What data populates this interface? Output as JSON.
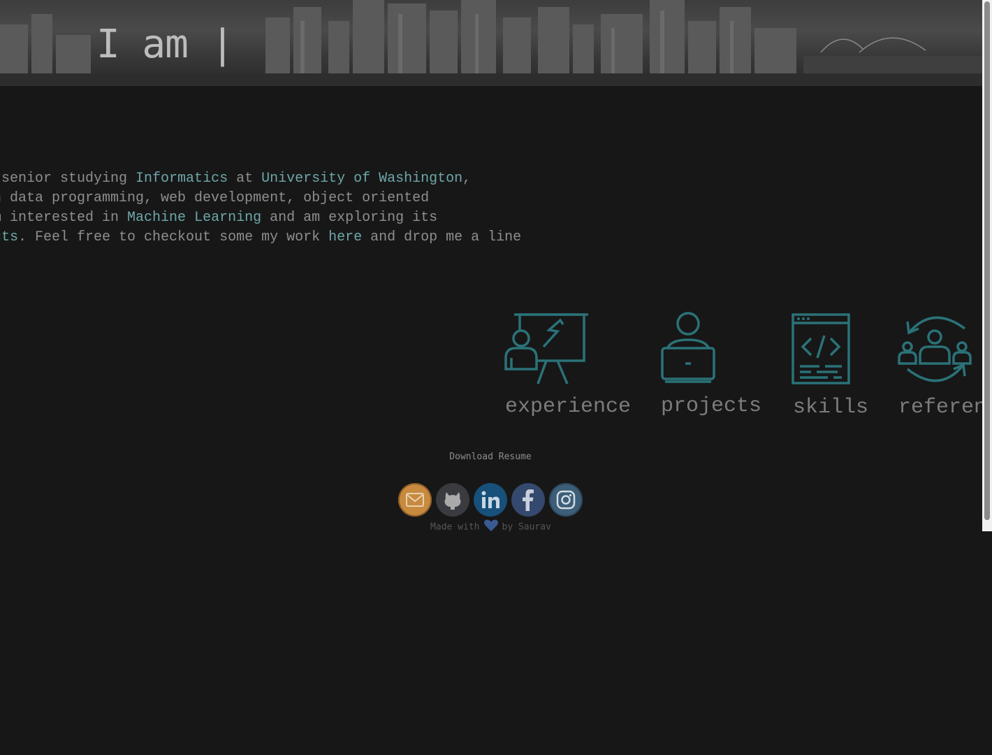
{
  "hero": {
    "title": "I am |"
  },
  "intro": {
    "line1": {
      "pre": "a senior studying ",
      "link1": "Informatics",
      "mid": " at ",
      "link2": "University of Washington",
      "post": ","
    },
    "line2": "in data programming, web development, object oriented",
    "line3": {
      "pre": "am interested in ",
      "link": "Machine Learning",
      "post": " and am exploring its"
    },
    "line4": {
      "link1": "ects",
      "pre": ". Feel free to checkout some my work ",
      "link2": "here",
      "post": " and drop me a line"
    }
  },
  "nav": [
    {
      "label": "experience",
      "icon": "presentation-icon"
    },
    {
      "label": "projects",
      "icon": "person-laptop-icon"
    },
    {
      "label": "skills",
      "icon": "code-window-icon"
    },
    {
      "label": "references",
      "icon": "people-cycle-icon"
    }
  ],
  "resume": {
    "label": "Download Resume"
  },
  "socials": [
    {
      "name": "email",
      "icon": "mail-icon",
      "color": "#c78a3f"
    },
    {
      "name": "github",
      "icon": "github-icon",
      "color": "#3a3b40"
    },
    {
      "name": "linkedin",
      "icon": "linkedin-icon",
      "color": "#17507a"
    },
    {
      "name": "facebook",
      "icon": "facebook-icon",
      "color": "#35486e"
    },
    {
      "name": "instagram",
      "icon": "instagram-icon",
      "color": "#3c5e78"
    }
  ],
  "footer": {
    "pre": "Made with",
    "icon": "heart-icon",
    "post": "by Saurav"
  },
  "colors": {
    "accent": "#2a7278",
    "link": "#6ea7a9",
    "background": "#171717"
  }
}
